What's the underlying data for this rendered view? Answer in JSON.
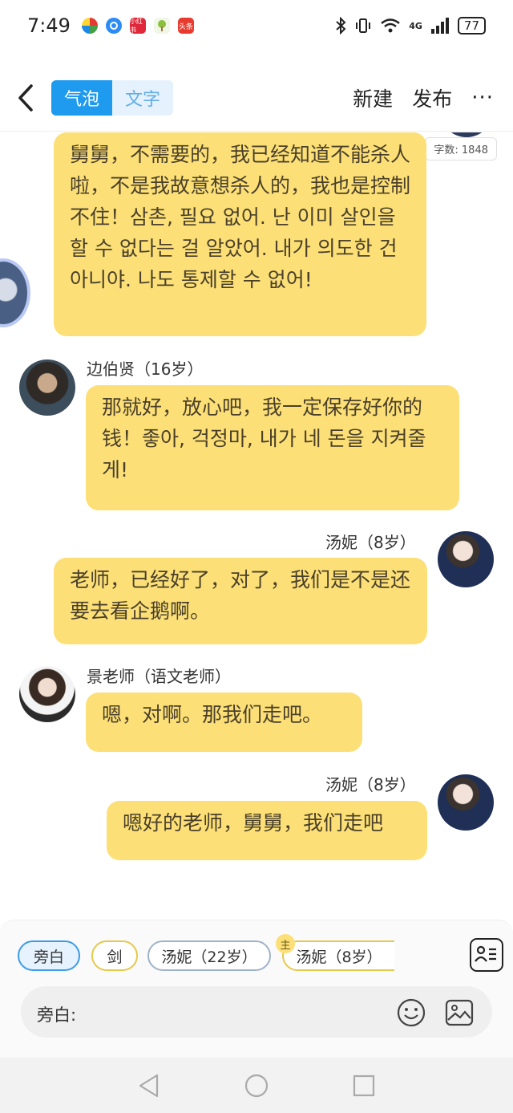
{
  "status_bar": {
    "time": "7:49",
    "apps": [
      {
        "name": "multicolor-app-icon",
        "label": "",
        "color": "#2a9fd6"
      },
      {
        "name": "blue-circle-app-icon",
        "label": "",
        "color": "#2c8cf4"
      },
      {
        "name": "xiaohongshu-app-icon",
        "label": "小红书",
        "color": "#e0283a"
      },
      {
        "name": "tree-app-icon",
        "label": "",
        "color": "#8bbf3c"
      },
      {
        "name": "toutiao-app-icon",
        "label": "头条",
        "color": "#e83a2e"
      }
    ],
    "network": "4G",
    "battery": "77"
  },
  "nav": {
    "tabs": [
      {
        "label": "气泡",
        "active": true
      },
      {
        "label": "文字",
        "active": false
      }
    ],
    "new_label": "新建",
    "publish_label": "发布",
    "more_label": "···"
  },
  "chat": {
    "word_count": "字数: 1848",
    "messages": [
      {
        "speaker": "",
        "side": "right",
        "text": "舅舅，不需要的，我已经知道不能杀人啦，不是我故意想杀人的，我也是控制不住！삼촌, 필요 없어. 난 이미 살인을 할 수 없다는 걸 알았어. 내가 의도한 건 아니야. 나도 통제할 수 없어!"
      },
      {
        "speaker": "边伯贤（16岁）",
        "side": "left",
        "text": "那就好，放心吧，我一定保存好你的钱！좋아, 걱정마, 내가 네 돈을 지켜줄게!"
      },
      {
        "speaker": "汤妮（8岁）",
        "side": "right",
        "text": "老师，已经好了，对了，我们是不是还要去看企鹅啊。"
      },
      {
        "speaker": "景老师（语文老师）",
        "side": "left",
        "text": "嗯，对啊。那我们走吧。"
      },
      {
        "speaker": "汤妮（8岁）",
        "side": "right",
        "text": "嗯好的老师，舅舅，我们走吧"
      }
    ]
  },
  "roles": {
    "chips": [
      "旁白",
      "剑",
      "汤妮（22岁）",
      "汤妮（8岁）"
    ],
    "main_badge": "主"
  },
  "input": {
    "label": "旁白:"
  },
  "colors": {
    "bubble": "#fce077",
    "accent": "#1e9bef"
  }
}
